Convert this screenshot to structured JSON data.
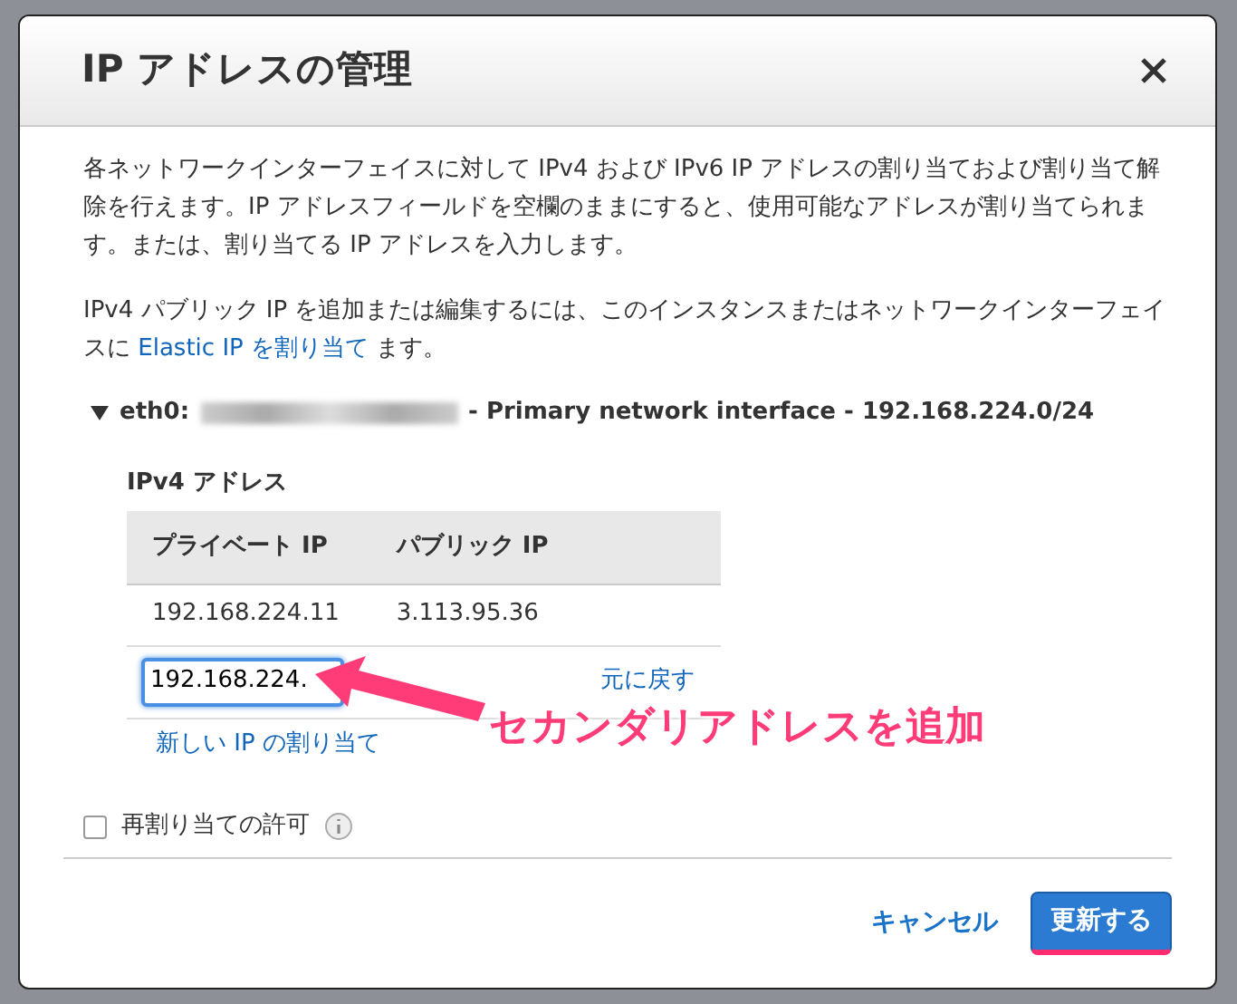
{
  "dialog": {
    "title": "IP アドレスの管理",
    "description": "各ネットワークインターフェイスに対して IPv4 および IPv6 IP アドレスの割り当ておよび割り当て解除を行えます。IP アドレスフィールドを空欄のままにすると、使用可能なアドレスが割り当てられます。または、割り当てる IP アドレスを入力します。",
    "note_before": "IPv4 パブリック IP を追加または編集するには、このインスタンスまたはネットワークインターフェイスに ",
    "note_link": "Elastic IP を割り当て",
    "note_after": " ます。",
    "interface": {
      "expanded": true,
      "label": "eth0:",
      "detail": "- Primary network interface - 192.168.224.0/24"
    },
    "ipv4_heading": "IPv4 アドレス",
    "table": {
      "columns": [
        "プライベート IP",
        "パブリック IP"
      ],
      "rows": [
        {
          "kind": "static",
          "private_ip": "192.168.224.11",
          "public_ip": "3.113.95.36"
        },
        {
          "kind": "edit",
          "value": "192.168.224.",
          "action": "元に戻す"
        }
      ]
    },
    "add_link": "新しい IP の割り当て",
    "reassign": {
      "label": "再割り当ての許可",
      "checked": false
    },
    "buttons": [
      {
        "label": "キャンセル",
        "kind": "link"
      },
      {
        "label": "更新する",
        "kind": "primary"
      }
    ]
  },
  "annotation": {
    "text": "セカンダリアドレスを追加"
  }
}
